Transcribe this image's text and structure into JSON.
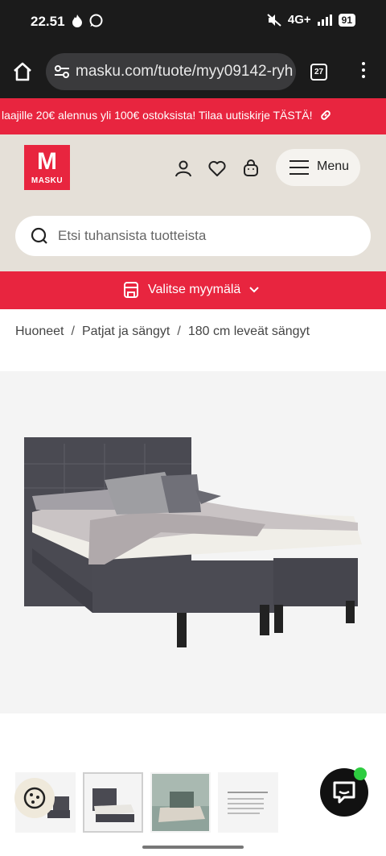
{
  "status_bar": {
    "time": "22.51",
    "network": "4G+",
    "battery": "91"
  },
  "browser": {
    "url": "masku.com/tuote/myy09142-ryh",
    "tab_count": "27"
  },
  "promo": {
    "text": "laajille 20€ alennus yli 100€ ostoksista! Tilaa uutiskirje TÄSTÄ!"
  },
  "header": {
    "logo_text": "MASKU",
    "menu_label": "Menu",
    "search_placeholder": "Etsi tuhansista tuotteista"
  },
  "store_selector": {
    "label": "Valitse myymälä"
  },
  "breadcrumb": [
    "Huoneet",
    "Patjat ja sängyt",
    "180 cm leveät sängyt"
  ],
  "colors": {
    "brand": "#e8253f",
    "header_bg": "#e5e0d8",
    "chat_status": "#2ecc40"
  },
  "icons": [
    "home-icon",
    "site-settings-icon",
    "tabs-icon",
    "more-icon",
    "link-icon",
    "user-icon",
    "heart-icon",
    "cart-icon",
    "menu-icon",
    "search-icon",
    "store-icon",
    "chevron-down-icon",
    "cookie-icon",
    "chat-icon"
  ]
}
